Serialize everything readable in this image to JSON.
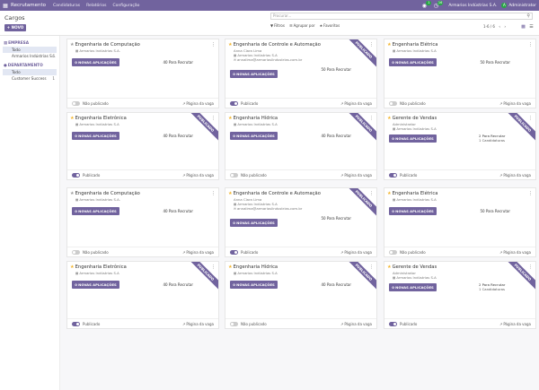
{
  "topbar": {
    "app_name": "Recrutamento",
    "menu": [
      "Candidaturas",
      "Relatórios",
      "Configuração"
    ],
    "chat_count": "1",
    "activity_count": "16",
    "company": "Armarios Indústrias S.A.",
    "avatar_letter": "A",
    "user": "Administrator"
  },
  "control": {
    "breadcrumb": "Cargos",
    "new_button": "+ NOVO",
    "search_placeholder": "Procurar...",
    "filters_label": "Filtros",
    "group_by_label": "Agrupar por",
    "favorites_label": "Favoritos",
    "pager": "1-6 / 6"
  },
  "sidebar": {
    "sections": [
      {
        "title": "EMPRESA",
        "items": [
          {
            "label": "Todo",
            "active": true,
            "count": ""
          },
          {
            "label": "Armarios Indústrias S...",
            "active": false,
            "count": "6"
          }
        ]
      },
      {
        "title": "DEPARTAMENTO",
        "items": [
          {
            "label": "Todo",
            "active": true,
            "count": ""
          },
          {
            "label": "Customer Success",
            "active": false,
            "count": "1"
          }
        ]
      }
    ]
  },
  "cards": [
    {
      "title": "Engenharia de Computação",
      "favorite": false,
      "company": "Armarios Indústrias S.A.",
      "contact": "",
      "email": "",
      "button": "0 NOVAS APLICAÇÕES",
      "recruit": "40 Para Recrutar",
      "candidates": "",
      "published": false,
      "pub_label": "Não publicado",
      "page_link": "Página da vaga",
      "ribbon": ""
    },
    {
      "title": "Engenharia de Controle e Automação",
      "favorite": true,
      "company": "",
      "contact": "Anna Clara Lima",
      "company2": "Armarios Indústrias S.A",
      "email": "annalima@armarioslindustrias.com.br",
      "button": "0 NOVAS APLICAÇÕES",
      "recruit": "50 Para Recrutar",
      "candidates": "",
      "published": true,
      "pub_label": "Publicado",
      "page_link": "Página da vaga",
      "ribbon": "PUBLICADO"
    },
    {
      "title": "Engenharia Elétrica",
      "favorite": true,
      "company": "Armarios Indústrias S.A",
      "contact": "",
      "email": "",
      "button": "0 NOVAS APLICAÇÕES",
      "recruit": "50 Para Recrutar",
      "candidates": "",
      "published": false,
      "pub_label": "Não publicado",
      "page_link": "Página da vaga",
      "ribbon": ""
    },
    {
      "title": "Engenharia Eletrônica",
      "favorite": true,
      "company": "Armarios Indústrias S.A",
      "contact": "",
      "email": "",
      "button": "0 NOVAS APLICAÇÕES",
      "recruit": "40 Para Recrutar",
      "candidates": "",
      "published": true,
      "pub_label": "Publicado",
      "page_link": "Página da vaga",
      "ribbon": "PUBLICADO"
    },
    {
      "title": "Engenharia Hídrica",
      "favorite": true,
      "company": "Armarios Indústrias S.A",
      "contact": "",
      "email": "",
      "button": "0 NOVAS APLICAÇÕES",
      "recruit": "40 Para Recrutar",
      "candidates": "",
      "published": false,
      "pub_label": "Não publicado",
      "page_link": "Página da vaga",
      "ribbon": "PUBLICADO"
    },
    {
      "title": "Gerente de Vendas",
      "favorite": true,
      "company": "",
      "contact": "Administrator",
      "company2": "Armarios Indústrias S.A",
      "email": "",
      "button": "0 NOVAS APLICAÇÕES",
      "recruit": "2 Para Recrutar",
      "candidates": "1 Candidaturas",
      "published": true,
      "pub_label": "Publicado",
      "page_link": "Página da vaga",
      "ribbon": "PUBLICADO"
    }
  ],
  "colors": {
    "brand": "#71639e",
    "favorite": "#f3b52b",
    "notification": "#28a745"
  }
}
